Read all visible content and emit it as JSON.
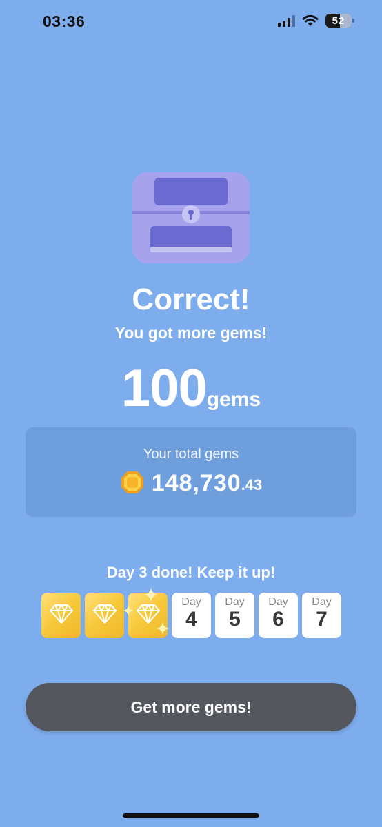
{
  "status_bar": {
    "time": "03:36",
    "battery": "52"
  },
  "result": {
    "title": "Correct!",
    "subtitle": "You got more gems!",
    "reward_amount": "100",
    "reward_unit": "gems"
  },
  "total": {
    "label": "Your total gems",
    "value": "148,730",
    "decimal": ".43"
  },
  "streak": {
    "message": "Day 3 done! Keep it up!",
    "completed_days": 3,
    "days": [
      {
        "label": "Day",
        "number": "4"
      },
      {
        "label": "Day",
        "number": "5"
      },
      {
        "label": "Day",
        "number": "6"
      },
      {
        "label": "Day",
        "number": "7"
      }
    ]
  },
  "cta": {
    "label": "Get more gems!"
  },
  "colors": {
    "background": "#7eaded",
    "card": "#6f9edd",
    "gold": "#f7c83a",
    "chest": "#a6a2ec",
    "button": "#54575d"
  },
  "icons": [
    "wifi-icon",
    "signal-icon",
    "battery-icon",
    "treasure-chest-icon",
    "gem-coin-icon",
    "diamond-icon",
    "sparkle-icon"
  ]
}
